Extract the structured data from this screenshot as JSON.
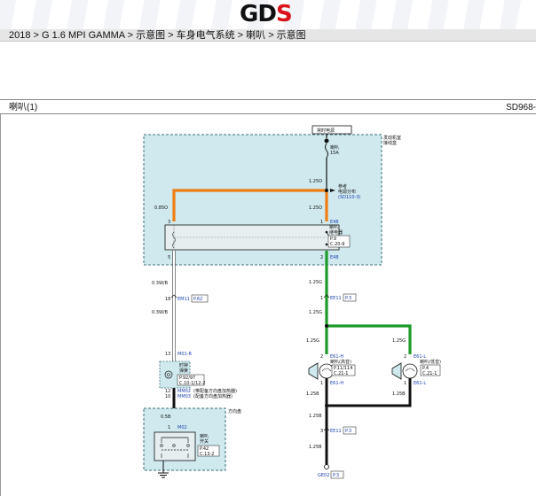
{
  "header": {
    "logo_left": "GD",
    "logo_right": "S",
    "breadcrumb": "2018 > G 1.6 MPI GAMMA > 示意图 > 车身电气系统 > 喇叭 > 示意图"
  },
  "diagram": {
    "title": "喇叭(1)",
    "code": "SD968-",
    "power_label": "常时电源",
    "engine_box_label": [
      "发动机室",
      "接线盒"
    ],
    "fuse_label": [
      "喇叭",
      "15A"
    ],
    "wire_1_25O_top": "1.25O",
    "ref_text": [
      "参考",
      "电源分布"
    ],
    "ref_link": "(SD110-3)",
    "wire_0_85O": "0.85O",
    "wire_1_25O_mid": "1.25O",
    "pin_3": "3",
    "pin_1_top": "1",
    "conn_E48_top": "E48",
    "relay_label": [
      "喇叭",
      "继电器"
    ],
    "relay_ref": [
      "P.9",
      "C.20-9"
    ],
    "pin_5": "5",
    "pin_2": "2",
    "conn_E48_bottom": "E48",
    "wire_0_3WB_1": "0.3W/B",
    "wire_1_25G_1": "1.25G",
    "pin_18": "18",
    "conn_EM11": "EM11",
    "ref_EM11": "P.62",
    "pin_1_ee11": "1",
    "conn_EE11_top": "EE11",
    "ref_EE11_top": "P.3",
    "wire_0_3WB_2": "0.3W/B",
    "wire_1_25G_2": "1.25G",
    "wire_1_25G_3": "1.25G",
    "wire_1_25G_4": "1.25G",
    "pin_13_m01": "13",
    "conn_M01R": "M01-R",
    "clock_spring_label": [
      "时钟",
      "弹簧"
    ],
    "clock_spring_ref": [
      "P.92/97",
      "C.10-1/12-2"
    ],
    "pin_2_h": "2",
    "conn_E61H": "E61-H",
    "horn_high_label": "喇叭(高音)",
    "horn_high_ref": [
      "P.11/114",
      "C.21-1"
    ],
    "pin_1_h": "1",
    "conn_E61H_b": "E61-H",
    "pin_2_l": "2",
    "conn_E61L": "E61-L",
    "horn_low_label": "喇叭(低音)",
    "horn_low_ref": [
      "P.4",
      "C.21-1"
    ],
    "pin_1_l": "1",
    "conn_E61L_b": "E61-L",
    "pin_12": "12",
    "conn_MM02": "MM02",
    "mm02_note": "(带配备方向盘加热器)",
    "pin_10": "10",
    "conn_MM03": "MM03",
    "mm03_note": "(配备方向盘加热器)",
    "steering_label": "方向盘",
    "wire_0_5B": "0.5B",
    "pin_1_m02": "1",
    "conn_M02": "M02",
    "horn_switch_label": [
      "喇叭",
      "开关"
    ],
    "horn_switch_ref": [
      "P.42",
      "C.13-2"
    ],
    "wire_1_25B_1": "1.25B",
    "wire_1_25B_2": "1.25B",
    "wire_1_25B_3": "1.25B",
    "pin_3_ee11": "3",
    "conn_EE11_bot": "EE11",
    "ref_EE11_bot": "P.3",
    "wire_1_25B_4": "1.25B",
    "ground_label": "GE02",
    "ground_ref": "P.3",
    "colors": {
      "orange": "#f07d13",
      "green": "#1d9a2a",
      "black": "#111111",
      "box_fill": "#cfe9ee",
      "link_blue": "#1a3fb0"
    }
  }
}
